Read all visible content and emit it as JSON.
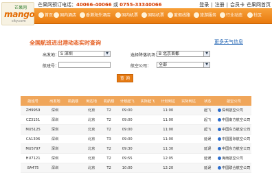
{
  "header": {
    "logo_top": "芒果网",
    "logo_main": "mango",
    "logo_sub": "city.com",
    "hotline_label": "芒果网预订电话：",
    "hotline_1": "40066-40066",
    "hotline_sep": "或",
    "hotline_2": "0755-33340066",
    "links": [
      "登录",
      "注册",
      "|",
      "会员卡",
      "|",
      "芒果网首页"
    ]
  },
  "nav": [
    "首页",
    "国内酒店",
    "香港海外酒店",
    "国内机票",
    "国际机票",
    "度假线路",
    "旅游服务",
    "行业动态",
    "社区"
  ],
  "panel": {
    "title": "全国航班进出港动态实时查询",
    "back_link": "更多天气信息",
    "origin_label": "出发地：",
    "origin_value": "S 深圳",
    "dest_label": "选择降落机场：",
    "dest_value": "B 北京首都",
    "flight_label": "航班号：",
    "flight_value": "",
    "airline_label": "航空公司：",
    "airline_value": "全部",
    "search_label": "查 询"
  },
  "table": {
    "headers": [
      "航班号",
      "出发地",
      "机航楼",
      "到达地",
      "机航楼",
      "计划起飞",
      "实际起飞",
      "计划到达",
      "实际到达",
      "状态",
      "航空公司"
    ],
    "rows": [
      [
        "ZH9959",
        "深圳",
        "",
        "北京",
        "T2",
        "09:00",
        "",
        "11:00",
        "",
        "起飞",
        "深圳航空公司"
      ],
      [
        "CZ3151",
        "深圳",
        "",
        "北京",
        "T2",
        "09:00",
        "",
        "11:00",
        "",
        "起飞",
        "中国南方航空公司"
      ],
      [
        "MU5125",
        "深圳",
        "",
        "北京",
        "T2",
        "09:00",
        "",
        "11:00",
        "",
        "起飞",
        "中国东方航空公司"
      ],
      [
        "CA1306",
        "深圳",
        "",
        "北京",
        "T3",
        "09:00",
        "",
        "11:00",
        "",
        "延误",
        "中国国际航空公司"
      ],
      [
        "MU5797",
        "深圳",
        "",
        "北京",
        "T2",
        "09:30",
        "",
        "11:30",
        "",
        "延误",
        "中国东方航空公司"
      ],
      [
        "HU7121",
        "深圳",
        "",
        "北京",
        "T2",
        "09:55",
        "",
        "12:05",
        "",
        "延误",
        "海南航空公司"
      ],
      [
        "8A475",
        "深圳",
        "",
        "北京",
        "T2",
        "10:00",
        "",
        "12:20",
        "",
        "延误",
        "中国联合航空公司"
      ]
    ]
  }
}
